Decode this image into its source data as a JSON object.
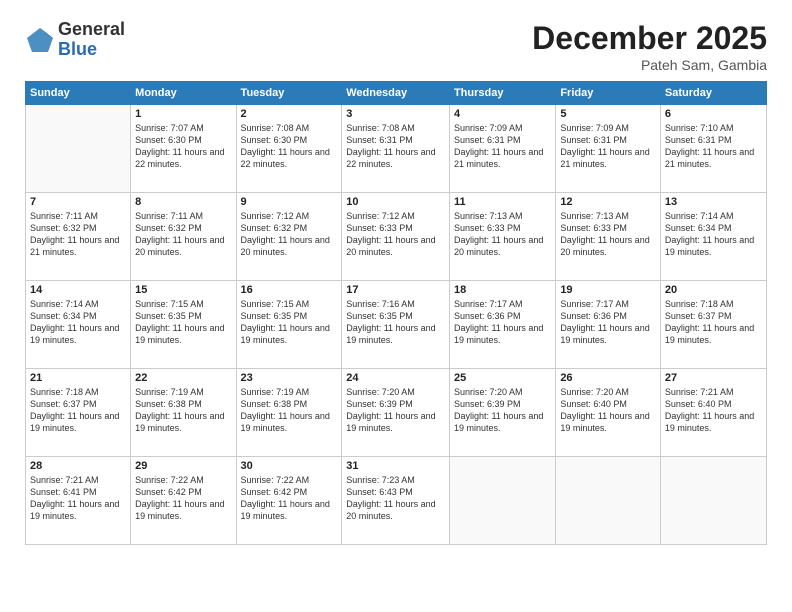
{
  "logo": {
    "general": "General",
    "blue": "Blue"
  },
  "title": "December 2025",
  "location": "Pateh Sam, Gambia",
  "days_of_week": [
    "Sunday",
    "Monday",
    "Tuesday",
    "Wednesday",
    "Thursday",
    "Friday",
    "Saturday"
  ],
  "weeks": [
    [
      {
        "num": "",
        "sunrise": "",
        "sunset": "",
        "daylight": ""
      },
      {
        "num": "1",
        "sunrise": "Sunrise: 7:07 AM",
        "sunset": "Sunset: 6:30 PM",
        "daylight": "Daylight: 11 hours and 22 minutes."
      },
      {
        "num": "2",
        "sunrise": "Sunrise: 7:08 AM",
        "sunset": "Sunset: 6:30 PM",
        "daylight": "Daylight: 11 hours and 22 minutes."
      },
      {
        "num": "3",
        "sunrise": "Sunrise: 7:08 AM",
        "sunset": "Sunset: 6:31 PM",
        "daylight": "Daylight: 11 hours and 22 minutes."
      },
      {
        "num": "4",
        "sunrise": "Sunrise: 7:09 AM",
        "sunset": "Sunset: 6:31 PM",
        "daylight": "Daylight: 11 hours and 21 minutes."
      },
      {
        "num": "5",
        "sunrise": "Sunrise: 7:09 AM",
        "sunset": "Sunset: 6:31 PM",
        "daylight": "Daylight: 11 hours and 21 minutes."
      },
      {
        "num": "6",
        "sunrise": "Sunrise: 7:10 AM",
        "sunset": "Sunset: 6:31 PM",
        "daylight": "Daylight: 11 hours and 21 minutes."
      }
    ],
    [
      {
        "num": "7",
        "sunrise": "Sunrise: 7:11 AM",
        "sunset": "Sunset: 6:32 PM",
        "daylight": "Daylight: 11 hours and 21 minutes."
      },
      {
        "num": "8",
        "sunrise": "Sunrise: 7:11 AM",
        "sunset": "Sunset: 6:32 PM",
        "daylight": "Daylight: 11 hours and 20 minutes."
      },
      {
        "num": "9",
        "sunrise": "Sunrise: 7:12 AM",
        "sunset": "Sunset: 6:32 PM",
        "daylight": "Daylight: 11 hours and 20 minutes."
      },
      {
        "num": "10",
        "sunrise": "Sunrise: 7:12 AM",
        "sunset": "Sunset: 6:33 PM",
        "daylight": "Daylight: 11 hours and 20 minutes."
      },
      {
        "num": "11",
        "sunrise": "Sunrise: 7:13 AM",
        "sunset": "Sunset: 6:33 PM",
        "daylight": "Daylight: 11 hours and 20 minutes."
      },
      {
        "num": "12",
        "sunrise": "Sunrise: 7:13 AM",
        "sunset": "Sunset: 6:33 PM",
        "daylight": "Daylight: 11 hours and 20 minutes."
      },
      {
        "num": "13",
        "sunrise": "Sunrise: 7:14 AM",
        "sunset": "Sunset: 6:34 PM",
        "daylight": "Daylight: 11 hours and 19 minutes."
      }
    ],
    [
      {
        "num": "14",
        "sunrise": "Sunrise: 7:14 AM",
        "sunset": "Sunset: 6:34 PM",
        "daylight": "Daylight: 11 hours and 19 minutes."
      },
      {
        "num": "15",
        "sunrise": "Sunrise: 7:15 AM",
        "sunset": "Sunset: 6:35 PM",
        "daylight": "Daylight: 11 hours and 19 minutes."
      },
      {
        "num": "16",
        "sunrise": "Sunrise: 7:15 AM",
        "sunset": "Sunset: 6:35 PM",
        "daylight": "Daylight: 11 hours and 19 minutes."
      },
      {
        "num": "17",
        "sunrise": "Sunrise: 7:16 AM",
        "sunset": "Sunset: 6:35 PM",
        "daylight": "Daylight: 11 hours and 19 minutes."
      },
      {
        "num": "18",
        "sunrise": "Sunrise: 7:17 AM",
        "sunset": "Sunset: 6:36 PM",
        "daylight": "Daylight: 11 hours and 19 minutes."
      },
      {
        "num": "19",
        "sunrise": "Sunrise: 7:17 AM",
        "sunset": "Sunset: 6:36 PM",
        "daylight": "Daylight: 11 hours and 19 minutes."
      },
      {
        "num": "20",
        "sunrise": "Sunrise: 7:18 AM",
        "sunset": "Sunset: 6:37 PM",
        "daylight": "Daylight: 11 hours and 19 minutes."
      }
    ],
    [
      {
        "num": "21",
        "sunrise": "Sunrise: 7:18 AM",
        "sunset": "Sunset: 6:37 PM",
        "daylight": "Daylight: 11 hours and 19 minutes."
      },
      {
        "num": "22",
        "sunrise": "Sunrise: 7:19 AM",
        "sunset": "Sunset: 6:38 PM",
        "daylight": "Daylight: 11 hours and 19 minutes."
      },
      {
        "num": "23",
        "sunrise": "Sunrise: 7:19 AM",
        "sunset": "Sunset: 6:38 PM",
        "daylight": "Daylight: 11 hours and 19 minutes."
      },
      {
        "num": "24",
        "sunrise": "Sunrise: 7:20 AM",
        "sunset": "Sunset: 6:39 PM",
        "daylight": "Daylight: 11 hours and 19 minutes."
      },
      {
        "num": "25",
        "sunrise": "Sunrise: 7:20 AM",
        "sunset": "Sunset: 6:39 PM",
        "daylight": "Daylight: 11 hours and 19 minutes."
      },
      {
        "num": "26",
        "sunrise": "Sunrise: 7:20 AM",
        "sunset": "Sunset: 6:40 PM",
        "daylight": "Daylight: 11 hours and 19 minutes."
      },
      {
        "num": "27",
        "sunrise": "Sunrise: 7:21 AM",
        "sunset": "Sunset: 6:40 PM",
        "daylight": "Daylight: 11 hours and 19 minutes."
      }
    ],
    [
      {
        "num": "28",
        "sunrise": "Sunrise: 7:21 AM",
        "sunset": "Sunset: 6:41 PM",
        "daylight": "Daylight: 11 hours and 19 minutes."
      },
      {
        "num": "29",
        "sunrise": "Sunrise: 7:22 AM",
        "sunset": "Sunset: 6:42 PM",
        "daylight": "Daylight: 11 hours and 19 minutes."
      },
      {
        "num": "30",
        "sunrise": "Sunrise: 7:22 AM",
        "sunset": "Sunset: 6:42 PM",
        "daylight": "Daylight: 11 hours and 19 minutes."
      },
      {
        "num": "31",
        "sunrise": "Sunrise: 7:23 AM",
        "sunset": "Sunset: 6:43 PM",
        "daylight": "Daylight: 11 hours and 20 minutes."
      },
      {
        "num": "",
        "sunrise": "",
        "sunset": "",
        "daylight": ""
      },
      {
        "num": "",
        "sunrise": "",
        "sunset": "",
        "daylight": ""
      },
      {
        "num": "",
        "sunrise": "",
        "sunset": "",
        "daylight": ""
      }
    ]
  ]
}
